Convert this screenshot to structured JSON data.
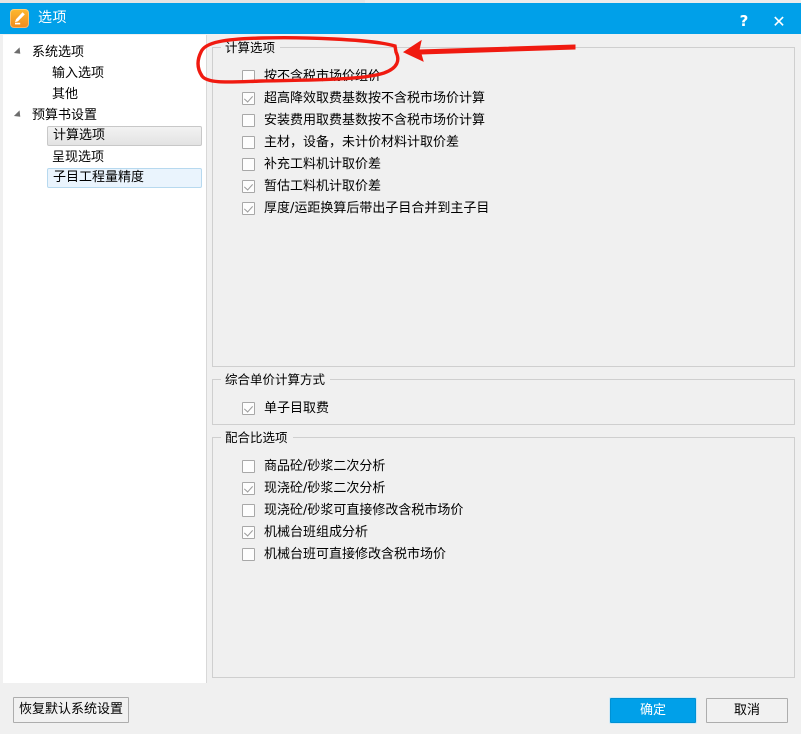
{
  "window": {
    "title": "选项",
    "icon": "edit-pen-icon",
    "help_label": "?",
    "close_label": "✕",
    "accent_color": "#00a0e9"
  },
  "sidebar": {
    "nodes": [
      {
        "label": "系统选项",
        "level": 0,
        "expander": "collapse-arrow-icon",
        "state": "normal"
      },
      {
        "label": "输入选项",
        "level": 1,
        "expander": "",
        "state": "normal"
      },
      {
        "label": "其他",
        "level": 1,
        "expander": "",
        "state": "normal"
      },
      {
        "label": "预算书设置",
        "level": 0,
        "expander": "collapse-arrow-icon",
        "state": "normal"
      },
      {
        "label": "计算选项",
        "level": 1,
        "expander": "",
        "state": "selected"
      },
      {
        "label": "呈现选项",
        "level": 1,
        "expander": "",
        "state": "normal"
      },
      {
        "label": "子目工程量精度",
        "level": 1,
        "expander": "",
        "state": "hover"
      }
    ]
  },
  "main": {
    "groups": [
      {
        "id": "gb-calc",
        "title": "计算选项",
        "items": [
          {
            "label": "按不含税市场价组价",
            "checked": false
          },
          {
            "label": "超高降效取费基数按不含税市场价计算",
            "checked": true
          },
          {
            "label": "安装费用取费基数按不含税市场价计算",
            "checked": false
          },
          {
            "label": "主材，设备，未计价材料计取价差",
            "checked": false
          },
          {
            "label": "补充工料机计取价差",
            "checked": false
          },
          {
            "label": "暂估工料机计取价差",
            "checked": true
          },
          {
            "label": "厚度/运距换算后带出子目合并到主子目",
            "checked": true
          }
        ]
      },
      {
        "id": "gb-unit",
        "title": "综合单价计算方式",
        "items": [
          {
            "label": "单子目取费",
            "checked": true
          }
        ]
      },
      {
        "id": "gb-mix",
        "title": "配合比选项",
        "items": [
          {
            "label": "商品砼/砂浆二次分析",
            "checked": false
          },
          {
            "label": "现浇砼/砂浆二次分析",
            "checked": true
          },
          {
            "label": "现浇砼/砂浆可直接修改含税市场价",
            "checked": false
          },
          {
            "label": "机械台班组成分析",
            "checked": true
          },
          {
            "label": "机械台班可直接修改含税市场价",
            "checked": false
          }
        ]
      }
    ]
  },
  "footer": {
    "restore_label": "恢复默认系统设置",
    "ok_label": "确定",
    "cancel_label": "取消"
  },
  "annotation": {
    "color": "#f01a10",
    "ellipse": "red-ellipse-highlight",
    "arrow": "red-arrow-pointer"
  }
}
